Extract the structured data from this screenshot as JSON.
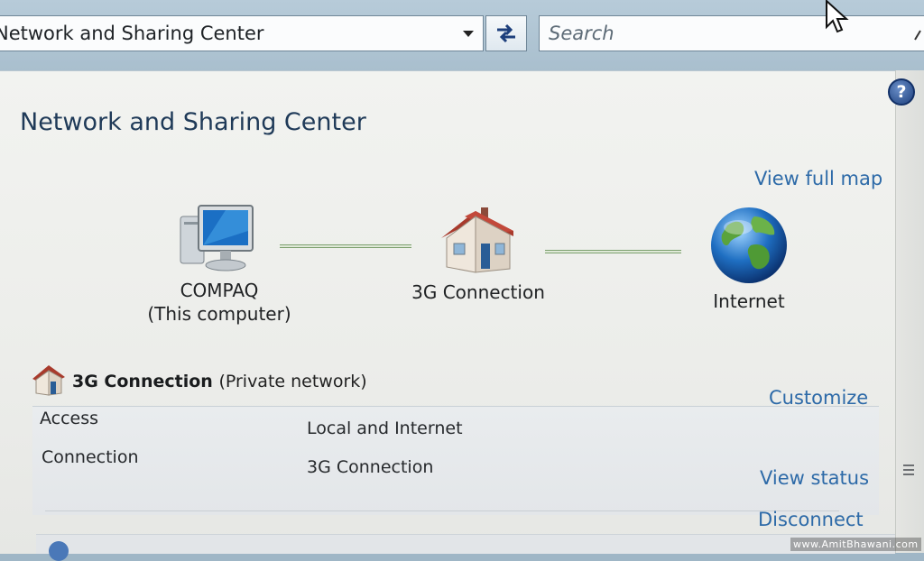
{
  "toolbar": {
    "address_text": "Network and Sharing Center",
    "search_placeholder": "Search"
  },
  "main": {
    "title": "Network and Sharing Center",
    "view_full_map": "View full map",
    "map": {
      "computer_name": "COMPAQ",
      "computer_note": "(This computer)",
      "network_name": "3G Connection",
      "internet_label": "Internet"
    },
    "network": {
      "name": "3G Connection",
      "type": "(Private network)",
      "customize": "Customize",
      "access_label": "Access",
      "access_value": "Local and Internet",
      "connection_label": "Connection",
      "connection_value": "3G Connection",
      "view_status": "View status",
      "disconnect": "Disconnect"
    },
    "help_glyph": "?"
  },
  "watermark": "www.AmitBhawani.com",
  "colors": {
    "link": "#2d6aa8",
    "title": "#1f3a58",
    "connector": "#7da06f"
  },
  "icons": [
    "dropdown-arrow-icon",
    "refresh-icon",
    "search-icon",
    "help-icon",
    "computer-icon",
    "house-icon",
    "globe-icon",
    "cursor-icon"
  ]
}
